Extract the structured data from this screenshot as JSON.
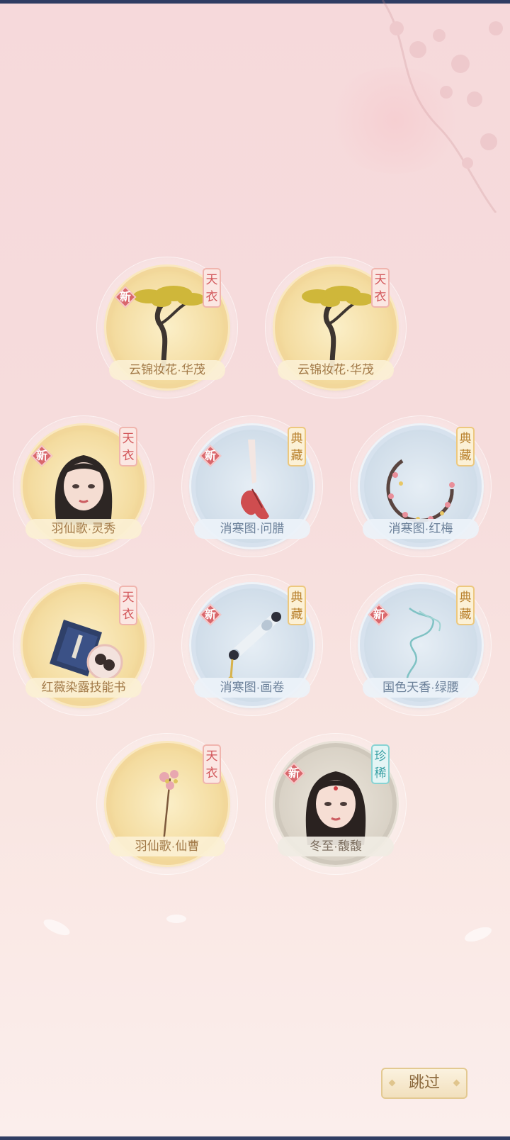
{
  "badges": {
    "new": "新"
  },
  "rarity": {
    "tianyi": [
      "天",
      "衣"
    ],
    "diancang": [
      "典",
      "藏"
    ],
    "zhenxi": [
      "珍",
      "稀"
    ]
  },
  "items": [
    {
      "name": "云锦妆花·华茂",
      "frame": "gold",
      "rarity": "tianyi",
      "is_new": true,
      "art": "tree-icon"
    },
    {
      "name": "云锦妆花·华茂",
      "frame": "gold",
      "rarity": "tianyi",
      "is_new": false,
      "art": "tree-icon"
    },
    {
      "name": "羽仙歌·灵秀",
      "frame": "gold",
      "rarity": "tianyi",
      "is_new": true,
      "art": "portrait"
    },
    {
      "name": "消寒图·问腊",
      "frame": "silver",
      "rarity": "diancang",
      "is_new": true,
      "art": "shoes-icon"
    },
    {
      "name": "消寒图·红梅",
      "frame": "silver",
      "rarity": "diancang",
      "is_new": false,
      "art": "plum-wreath-icon"
    },
    {
      "name": "红薇染露技能书",
      "frame": "gold",
      "rarity": "tianyi",
      "is_new": false,
      "art": "skill-book-icon"
    },
    {
      "name": "消寒图·画卷",
      "frame": "silver",
      "rarity": "diancang",
      "is_new": true,
      "art": "scroll-icon"
    },
    {
      "name": "国色天香·绿腰",
      "frame": "silver",
      "rarity": "diancang",
      "is_new": true,
      "art": "ribbon-icon"
    },
    {
      "name": "羽仙歌·仙曹",
      "frame": "gold",
      "rarity": "tianyi",
      "is_new": false,
      "art": "hairpin-icon"
    },
    {
      "name": "冬至·馥馥",
      "frame": "stone",
      "rarity": "zhenxi",
      "is_new": true,
      "art": "portrait"
    }
  ],
  "skip_label": "跳过"
}
